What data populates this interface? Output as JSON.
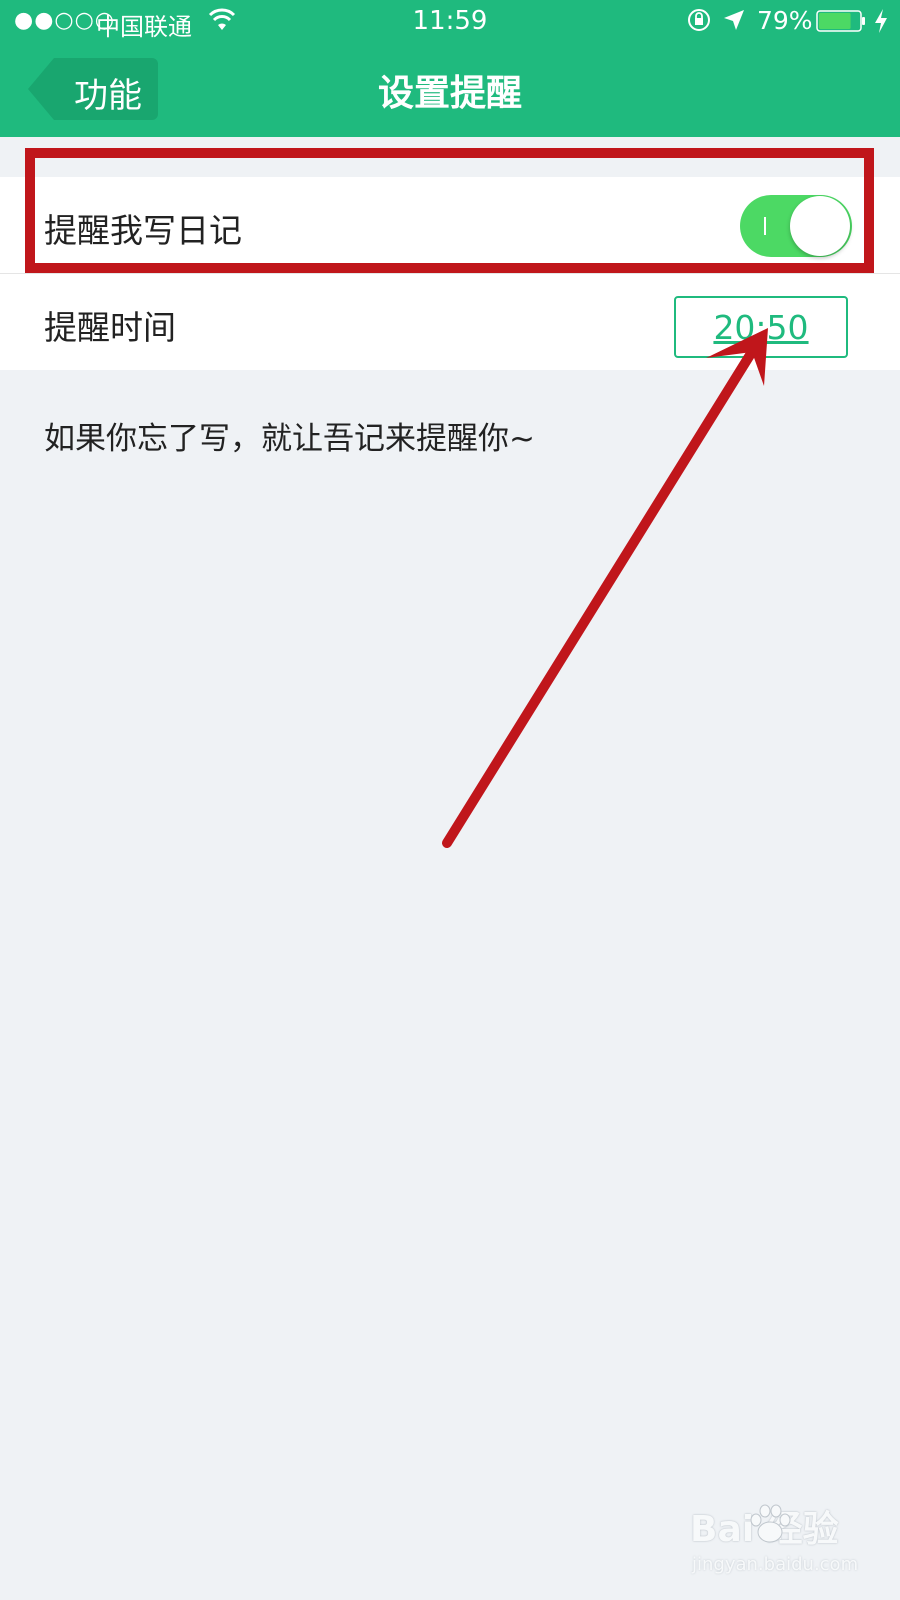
{
  "status_bar": {
    "signal": "●●○○○",
    "carrier": "中国联通",
    "time": "11:59",
    "battery_percent": "79%",
    "battery_level": 0.79,
    "icons": [
      "wifi-icon",
      "orientation-lock-icon",
      "location-icon",
      "battery-icon",
      "charging-icon"
    ]
  },
  "nav": {
    "back_label": "功能",
    "title": "设置提醒"
  },
  "settings": {
    "reminder_label": "提醒我写日记",
    "reminder_enabled": true,
    "time_label": "提醒时间",
    "time_value": "20:50"
  },
  "hint": "如果你忘了写，就让吾记来提醒你~",
  "watermark": {
    "main": "Bai  经验",
    "sub": "jingyan.baidu.com"
  },
  "colors": {
    "brand_green": "#1fba7e",
    "toggle_on": "#4cd964",
    "annotation_red": "#c0161b",
    "page_background": "#eff2f5"
  }
}
